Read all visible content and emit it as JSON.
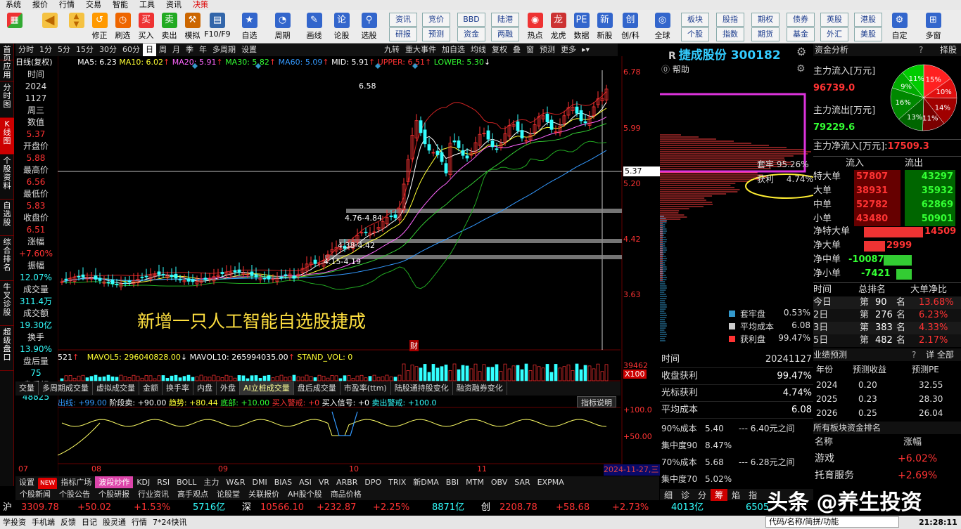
{
  "menu": [
    "系统",
    "报价",
    "行情",
    "交易",
    "智能",
    "工具",
    "资讯",
    "决策"
  ],
  "toolbar": {
    "buttons": [
      "修正",
      "刷选",
      "买入",
      "卖出",
      "模拟",
      "F10/F9",
      "自选",
      "周期",
      "画线",
      "论股",
      "选股",
      "热点",
      "龙虎",
      "数据",
      "新股",
      "创/科",
      "全球",
      "自定",
      "多窗"
    ],
    "small": [
      "资讯",
      "竞价",
      "BBD",
      "陆港",
      "研报",
      "预测",
      "资金",
      "两融",
      "板块",
      "股指",
      "期权",
      "债券",
      "英股",
      "港股",
      "个股",
      "指数",
      "期货",
      "基金",
      "外汇",
      "美股"
    ]
  },
  "leftnav": [
    "首页",
    "应用",
    "分时图",
    "K线图",
    "个股资料",
    "自选股",
    "综合排名",
    "牛叉诊股",
    "超级盘口"
  ],
  "period_tabs": [
    "分时",
    "1分",
    "5分",
    "15分",
    "30分",
    "60分",
    "日",
    "周",
    "月",
    "季",
    "年",
    "多周期",
    "设置"
  ],
  "period_active": "日",
  "right_tools": [
    "九转",
    "重大事件",
    "加自选",
    "均线",
    "复权",
    "叠",
    "窗",
    "预测",
    "更多"
  ],
  "indicators": {
    "label": "日线(复权)",
    "ma5": "MA5: 6.23",
    "ma10": "MA10: 6.02",
    "ma20": "MA20: 5.91",
    "ma30": "MA30: 5.82",
    "ma60": "MA60: 5.09",
    "mid": "MID: 5.91",
    "upper": "UPPER: 6.51",
    "lower": "LOWER: 5.30"
  },
  "info": {
    "time_label": "时间",
    "year": "2024",
    "date": "1127",
    "weekday": "周三",
    "items": [
      {
        "label": "数值",
        "value": "5.37",
        "color": "red"
      },
      {
        "label": "开盘价",
        "value": "5.88",
        "color": "red"
      },
      {
        "label": "最高价",
        "value": "6.56",
        "color": "red"
      },
      {
        "label": "最低价",
        "value": "5.83",
        "color": "red"
      },
      {
        "label": "收盘价",
        "value": "6.51",
        "color": "red"
      },
      {
        "label": "涨幅",
        "value": "+7.60%",
        "color": "red"
      },
      {
        "label": "振幅",
        "value": "12.07%",
        "color": "cyan"
      },
      {
        "label": "成交量",
        "value": "311.4万",
        "color": "cyan"
      },
      {
        "label": "成交额",
        "value": "19.30亿",
        "color": "cyan"
      },
      {
        "label": "换手",
        "value": "13.90%",
        "color": "cyan"
      },
      {
        "label": "盘后量",
        "value": "75",
        "color": "cyan"
      },
      {
        "label": "盘后额",
        "value": "48825",
        "color": "cyan"
      }
    ]
  },
  "price_axis": [
    "6.78",
    "5.99",
    "5.20",
    "4.42",
    "3.63"
  ],
  "cursor_price": "5.37",
  "annotations": {
    "high": "6.58",
    "z1": "4.76-4.84",
    "z2": "4.38-4.42",
    "z3": "4.15-4.19",
    "cai": "财"
  },
  "overlay_text": "新增一只人工智能自选股捷成",
  "volume_row": {
    "prev": "521",
    "mavol5": "MAVOL5: 296040828.00",
    "mavol10": "MAVOL10: 265994035.00",
    "stand": "STAND_VOL: 0",
    "axis_top": "39462",
    "axis_unit": "X100"
  },
  "sub_tabs": [
    "交量",
    "多周期成交量",
    "虚拟成交量",
    "金额",
    "换手率",
    "内盘",
    "外盘",
    "AI立桩成交量",
    "盘后成交量",
    "市盈率(ttm)",
    "陆股通持股变化",
    "融资融券变化"
  ],
  "sub_tab_active": "AI立桩成交量",
  "macd_row": {
    "a": "出线: +99.00",
    "b": "阶段卖: +90.00",
    "c": "趋势: +80.44",
    "d": "底部: +10.00",
    "e": "买入警戒: +0",
    "f": "买入信号: +0",
    "g": "卖出警戒: +100.0",
    "btn": "指标说明",
    "ax1": "+100.0",
    "ax2": "+50.00"
  },
  "month_axis": [
    "07",
    "08",
    "09",
    "10",
    "11"
  ],
  "date_label": "2024-11-27,三",
  "bottom_tabs": [
    "设置",
    "NEW",
    "指标广场",
    "波段炒作",
    "KDJ",
    "RSI",
    "BOLL",
    "主力",
    "W&R",
    "DMI",
    "BIAS",
    "ASI",
    "VR",
    "ARBR",
    "DPO",
    "TRIX",
    "新DMA",
    "BBI",
    "MTM",
    "OBV",
    "SAR",
    "EXPMA"
  ],
  "bottom_tab_active": "波段炒作",
  "news_tabs": [
    "个股新闻",
    "个股公告",
    "个股研报",
    "行业资讯",
    "高手观点",
    "论股堂",
    "关联报价",
    "AH股个股",
    "商品价格"
  ],
  "index_bar": [
    {
      "name": "沪",
      "price": "3309.78",
      "chg": "+50.02",
      "pct": "+1.53%",
      "amt": "5716亿"
    },
    {
      "name": "深",
      "price": "10566.10",
      "chg": "+232.87",
      "pct": "+2.25%",
      "amt": "8871亿"
    },
    {
      "name": "创",
      "price": "2208.78",
      "chg": "+58.68",
      "pct": "+2.73%",
      "amt": "4013亿"
    }
  ],
  "index_extra": "6505",
  "status_items": [
    "学投资",
    "手机端",
    "反馈",
    "日记",
    "股灵通",
    "行情",
    "7*24快讯"
  ],
  "status_search": "代码/名称/简拼/功能",
  "clock": "21:28:11",
  "stock_title": "捷成股份 300182",
  "stock_badge": "R",
  "help_label": "帮助",
  "chip": {
    "taolao": "套牢",
    "taolao_val": "95.26%",
    "huoli": "获利",
    "huoli_val": "4.74%",
    "legend": [
      {
        "label": "套牢盘",
        "value": "0.53%",
        "color": "#3399cc"
      },
      {
        "label": "平均成本",
        "value": "6.08",
        "color": "#cccccc"
      },
      {
        "label": "获利盘",
        "value": "99.47%",
        "color": "#ff3333"
      }
    ]
  },
  "chip_stats": [
    {
      "label": "时间",
      "value": "20241127"
    },
    {
      "label": "收盘获利",
      "value": "99.47%"
    },
    {
      "label": "光标获利",
      "value": "4.74%"
    },
    {
      "label": "平均成本",
      "value": "6.08"
    }
  ],
  "chip_conc": [
    {
      "label": "90%成本",
      "a": "5.40",
      "b": "6.40元之间"
    },
    {
      "label": "集中度90",
      "a": "8.47%",
      "b": ""
    },
    {
      "label": "70%成本",
      "a": "5.68",
      "b": "6.28元之间"
    },
    {
      "label": "集中度70",
      "a": "5.02%",
      "b": ""
    }
  ],
  "mid_tabs": [
    "细",
    "诊",
    "分",
    "筹",
    "焰",
    "指"
  ],
  "fund": {
    "title": "资金分析",
    "tab": "择股",
    "in_label": "主力流入[万元]",
    "in_val": "96739.0",
    "out_label": "主力流出[万元]",
    "out_val": "79229.6",
    "net_label": "主力净流入[万元]:",
    "net_val": "17509.3",
    "pie": [
      {
        "label": "15%",
        "value": 15,
        "color": "#ff2020"
      },
      {
        "label": "10%",
        "value": 10,
        "color": "#e01010"
      },
      {
        "label": "14%",
        "value": 14,
        "color": "#a00000"
      },
      {
        "label": "11%",
        "value": 11,
        "color": "#7a0000"
      },
      {
        "label": "13%",
        "value": 13,
        "color": "#006600"
      },
      {
        "label": "16%",
        "value": 16,
        "color": "#008800"
      },
      {
        "label": "9%",
        "value": 9,
        "color": "#00aa00"
      },
      {
        "label": "11%",
        "value": 11,
        "color": "#00cc00"
      }
    ],
    "hdr_in": "流入",
    "hdr_out": "流出",
    "rows": [
      {
        "label": "特大单",
        "in": "57807",
        "out": "43297"
      },
      {
        "label": "大单",
        "in": "38931",
        "out": "35932"
      },
      {
        "label": "中单",
        "in": "52782",
        "out": "62869"
      },
      {
        "label": "小单",
        "in": "43480",
        "out": "50901"
      }
    ],
    "net": [
      {
        "label": "净特大单",
        "value": "14509",
        "pos": true
      },
      {
        "label": "净大单",
        "value": "2999",
        "pos": true
      },
      {
        "label": "净中单",
        "value": "-10087",
        "pos": false
      },
      {
        "label": "净小单",
        "value": "-7421",
        "pos": false
      }
    ],
    "rank_hdr": [
      "时间",
      "总排名",
      "大单净比"
    ],
    "ranks": [
      {
        "t": "今日",
        "r": "90",
        "p": "13.68%"
      },
      {
        "t": "2日",
        "r": "276",
        "p": "6.23%"
      },
      {
        "t": "3日",
        "r": "383",
        "p": "4.33%"
      },
      {
        "t": "5日",
        "r": "482",
        "p": "2.17%"
      }
    ],
    "rank_prefix": "第",
    "rank_suffix": "名"
  },
  "forecast": {
    "title": "业绩预测",
    "more": "详 全部",
    "hdr": [
      "年份",
      "预测收益",
      "预测PE"
    ],
    "rows": [
      {
        "y": "2024",
        "e": "0.20",
        "pe": "32.55"
      },
      {
        "y": "2025",
        "e": "0.23",
        "pe": "28.30"
      },
      {
        "y": "2026",
        "e": "0.25",
        "pe": "26.04"
      }
    ]
  },
  "sector": {
    "title": "所有板块资金排名",
    "hdr": [
      "名称",
      "涨幅"
    ],
    "rows": [
      {
        "n": "游戏",
        "v": "+6.02%"
      },
      {
        "n": "托育服务",
        "v": "+2.69%"
      }
    ]
  },
  "watermark": "头条 @养生投资"
}
